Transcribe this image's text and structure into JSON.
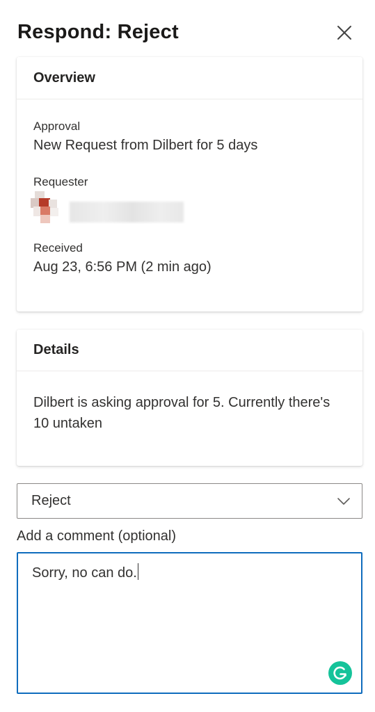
{
  "header": {
    "title": "Respond: Reject",
    "close_icon": "close-icon"
  },
  "overview": {
    "heading": "Overview",
    "approval_label": "Approval",
    "approval_value": "New Request from Dilbert for 5 days",
    "requester_label": "Requester",
    "requester_avatar_colors": [
      "#b23a2a",
      "#e07060",
      "#c8b8b0"
    ],
    "received_label": "Received",
    "received_value": "Aug 23, 6:56 PM (2 min ago)"
  },
  "details": {
    "heading": "Details",
    "text": "Dilbert is asking approval for 5. Currently there's 10 untaken"
  },
  "response": {
    "selected": "Reject",
    "dropdown_icon": "chevron-down-icon"
  },
  "comment": {
    "label": "Add a comment (optional)",
    "value": "Sorry, no can do.",
    "assistant_icon": "grammarly-icon"
  },
  "colors": {
    "focus_border": "#0f6cbd",
    "grammarly": "#15c39a"
  }
}
